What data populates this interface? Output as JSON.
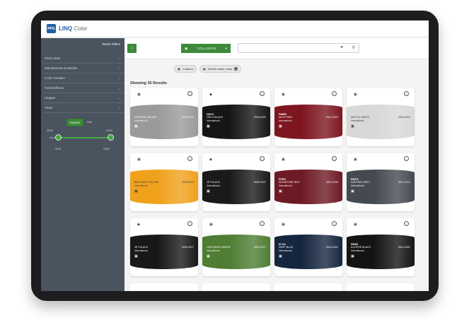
{
  "app": {
    "logo_text": "PPG",
    "title": "LINQ",
    "title_suffix": "Color"
  },
  "sidebar": {
    "reset_label": "Reset Filters",
    "filters": [
      "Paint Lines",
      "Manufacturer & Models",
      "Color Families",
      "Finish Effects",
      "Usages",
      "Years"
    ],
    "range": {
      "mode_on": "RANGE",
      "mode_off": "Year",
      "min_label": "2009",
      "max_label": "2022",
      "from_label": "2011",
      "to_label": "2022",
      "from_fraction": 0.15,
      "to_fraction": 1.0
    }
  },
  "toolbar": {
    "back_icon": "chevron-left-icon",
    "select_label": "COLLISION"
  },
  "chips": [
    {
      "label": "Collision"
    },
    {
      "label": "Vehicle make: tesla"
    }
  ],
  "results_label": "Showing 35 Results",
  "cards": [
    {
      "name": "STERLING SILVER",
      "code": "",
      "years": "2009-2013",
      "region": "International",
      "color": "#9a9a9a",
      "light": false,
      "top_icon": "square-icon"
    },
    {
      "name": "ONYX BLACK",
      "code": "ONYX",
      "years": "2016-2022",
      "region": "International",
      "color": "#161616",
      "light": false,
      "top_icon": "diamond-icon"
    },
    {
      "name": "MULTI RED",
      "code": "PMMR",
      "years": "2012-2022",
      "region": "International",
      "color": "#7e1620",
      "light": false,
      "top_icon": "square-icon"
    },
    {
      "name": "ARCTIC WHITE",
      "code": "",
      "years": "2009-2012",
      "region": "International",
      "color": "#d8d8d6",
      "light": true,
      "top_icon": "square-icon"
    },
    {
      "name": "BRILLIANT YELLOW",
      "code": "",
      "years": "2009-2012",
      "region": "International",
      "color": "#f0a11c",
      "light": true,
      "top_icon": "square-icon"
    },
    {
      "name": "JET BLACK",
      "code": "",
      "years": "2009-2017",
      "region": "International",
      "color": "#1a1a1a",
      "light": false,
      "top_icon": "diamond-icon"
    },
    {
      "name": "SIGNATURE RED",
      "code": "PPSR",
      "years": "2012-2016",
      "region": "International",
      "color": "#6e1a24",
      "light": false,
      "top_icon": "square-icon"
    },
    {
      "name": "DOLPHIN GREY",
      "code": "PMTG",
      "years": "2012-2014",
      "region": "International",
      "color": "#454a51",
      "light": false,
      "top_icon": "square-icon"
    },
    {
      "name": "JET BLACK",
      "code": "",
      "years": "2009-2017",
      "region": "International",
      "color": "#181818",
      "light": false,
      "top_icon": "diamond-icon"
    },
    {
      "name": "LIGHTNING GREEN",
      "code": "",
      "years": "2012-2017",
      "region": "International",
      "color": "#4f7d34",
      "light": false,
      "top_icon": "square-icon"
    },
    {
      "name": "DEEP BLUE",
      "code": "M 101",
      "years": "2015-2022",
      "region": "International",
      "color": "#17263f",
      "light": false,
      "top_icon": "square-icon"
    },
    {
      "name": "ECLIPSE BLACK",
      "code": "PBSB",
      "years": "2012-2022",
      "region": "International",
      "color": "#141414",
      "light": false,
      "top_icon": "square-icon"
    }
  ]
}
